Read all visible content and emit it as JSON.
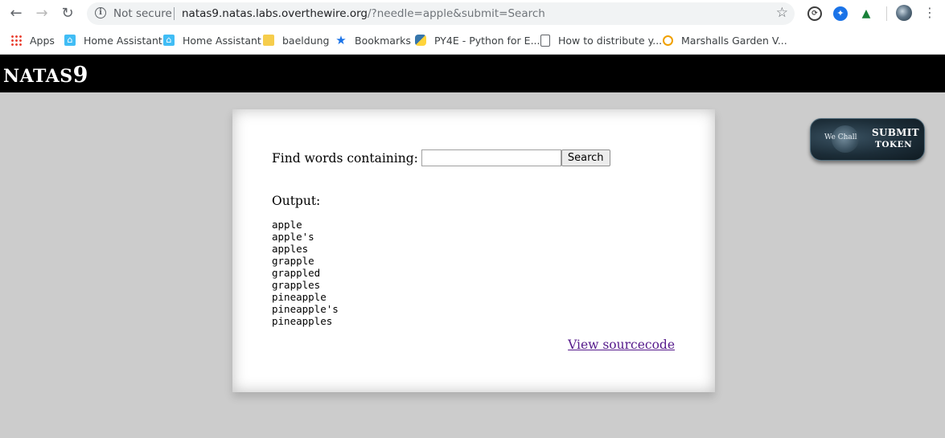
{
  "browser": {
    "security_label": "Not secure",
    "url_host": "natas9.natas.labs.overthewire.org",
    "url_query": "/?needle=apple&submit=Search"
  },
  "bookmarks": [
    {
      "label": "Apps",
      "icon": "apps-grid-icon"
    },
    {
      "label": "Home Assistant",
      "icon": "home-assistant-icon"
    },
    {
      "label": "Home Assistant",
      "icon": "home-assistant-icon"
    },
    {
      "label": "baeldung",
      "icon": "folder-icon"
    },
    {
      "label": "Bookmarks",
      "icon": "star-icon"
    },
    {
      "label": "PY4E - Python for E...",
      "icon": "python-icon"
    },
    {
      "label": "How to distribute y...",
      "icon": "document-icon"
    },
    {
      "label": "Marshalls Garden V...",
      "icon": "garden-icon"
    }
  ],
  "page": {
    "title_prefix": "NATAS",
    "title_number": "9",
    "search_label": "Find words containing:",
    "search_value": "",
    "search_button": "Search",
    "output_label": "Output:",
    "output_lines": [
      "apple",
      "apple's",
      "apples",
      "grapple",
      "grappled",
      "grapples",
      "pineapple",
      "pineapple's",
      "pineapples"
    ],
    "view_source": "View sourcecode"
  },
  "token_widget": {
    "brand": "We Chall",
    "line1": "SUBMIT",
    "line2": "TOKEN"
  }
}
